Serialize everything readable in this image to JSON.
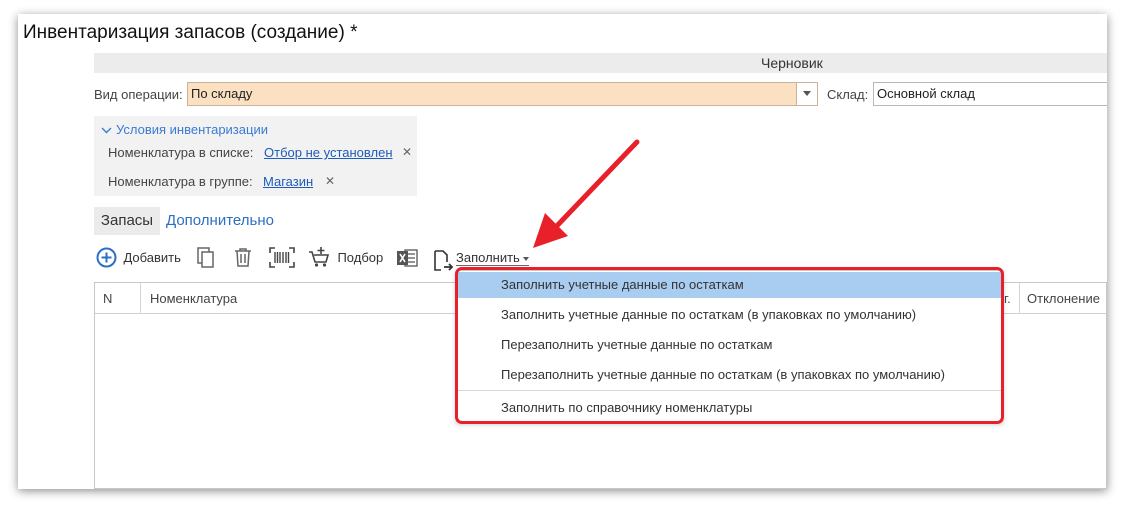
{
  "window": {
    "title": "Инвентаризация запасов (создание) *"
  },
  "status": {
    "text": "Черновик"
  },
  "form": {
    "operation_label": "Вид операции:",
    "operation_value": "По складу",
    "warehouse_label": "Склад:",
    "warehouse_value": "Основной склад"
  },
  "conditions": {
    "header": "Условия инвентаризации",
    "list_label": "Номенклатура в списке:",
    "list_value": "Отбор не установлен",
    "group_label": "Номенклатура в группе:",
    "group_value": "Магазин"
  },
  "tabs": [
    {
      "label": "Запасы",
      "active": true
    },
    {
      "label": "Дополнительно",
      "active": false
    }
  ],
  "toolbar": {
    "add_label": "Добавить",
    "pick_label": "Подбор",
    "fill_label": "Заполнить"
  },
  "table": {
    "columns": [
      "N",
      "Номенклатура",
      "Отклонение"
    ],
    "truncated_header": "г."
  },
  "fill_menu": {
    "items": [
      "Заполнить учетные данные по остаткам",
      "Заполнить учетные данные по остаткам (в упаковках по умолчанию)",
      "Перезаполнить учетные данные по остаткам",
      "Перезаполнить учетные данные по остаткам (в упаковках по умолчанию)",
      "Заполнить по справочнику номенклатуры"
    ],
    "highlighted_index": 0
  },
  "colors": {
    "accent_blue": "#1f5bb8",
    "operation_field_bg": "#fbe0c2",
    "menu_highlight": "#a9cdf0",
    "annotation_red": "#e8202a"
  },
  "icons": {
    "add": "plus-circle-icon",
    "copy": "copy-icon",
    "delete": "trash-icon",
    "barcode": "barcode-icon",
    "pick": "cart-icon",
    "excel": "excel-icon",
    "fill": "document-arrow-icon",
    "dropdown": "triangle-down-icon",
    "annotation": "red-arrow-icon"
  }
}
